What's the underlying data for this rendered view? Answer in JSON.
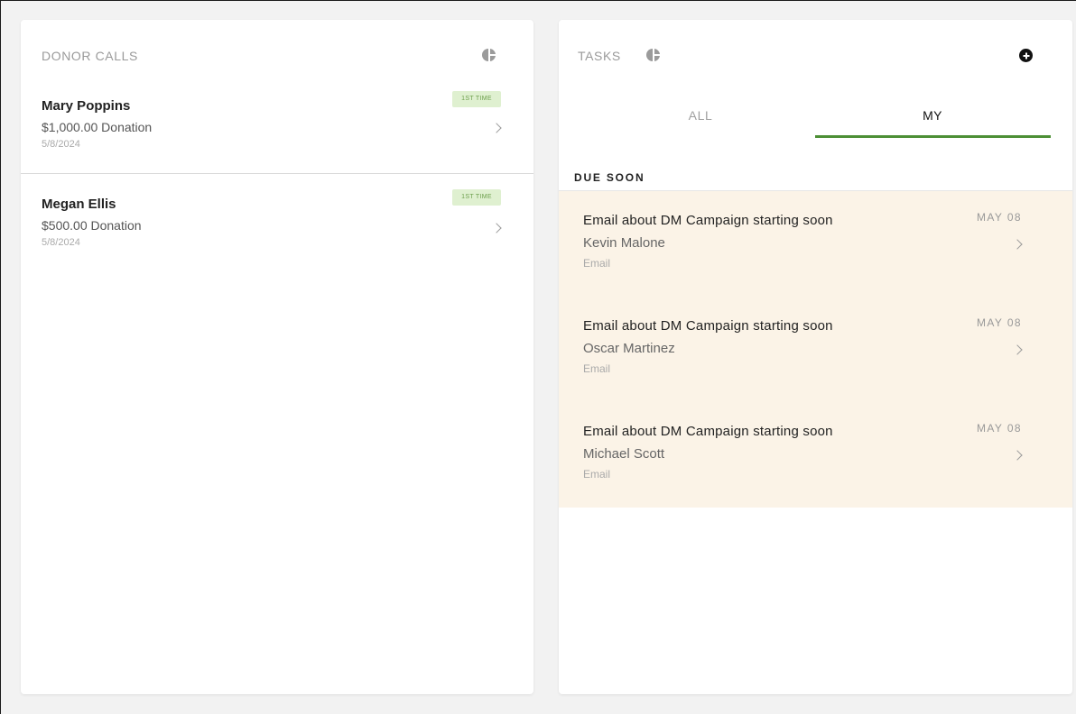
{
  "donor_calls": {
    "title": "DONOR CALLS",
    "icon": "pie-chart-icon",
    "items": [
      {
        "name": "Mary Poppins",
        "amount": "$1,000.00 Donation",
        "date": "5/8/2024",
        "badge": "1ST TIME"
      },
      {
        "name": "Megan Ellis",
        "amount": "$500.00 Donation",
        "date": "5/8/2024",
        "badge": "1ST TIME"
      }
    ]
  },
  "tasks": {
    "title": "TASKS",
    "icon": "pie-chart-icon",
    "add_icon": "plus-circle-icon",
    "tabs": [
      {
        "label": "ALL",
        "active": false
      },
      {
        "label": "MY",
        "active": true
      }
    ],
    "section": "DUE SOON",
    "items": [
      {
        "title": "Email about DM Campaign starting soon",
        "person": "Kevin Malone",
        "type": "Email",
        "date": "MAY 08"
      },
      {
        "title": "Email about DM Campaign starting soon",
        "person": "Oscar Martinez",
        "type": "Email",
        "date": "MAY 08"
      },
      {
        "title": "Email about DM Campaign starting soon",
        "person": "Michael Scott",
        "type": "Email",
        "date": "MAY 08"
      }
    ]
  },
  "colors": {
    "accent_green": "#4c8f35",
    "badge_bg": "#dff0d0",
    "badge_text": "#6ea04e",
    "due_soon_bg": "#fbf3e7"
  }
}
